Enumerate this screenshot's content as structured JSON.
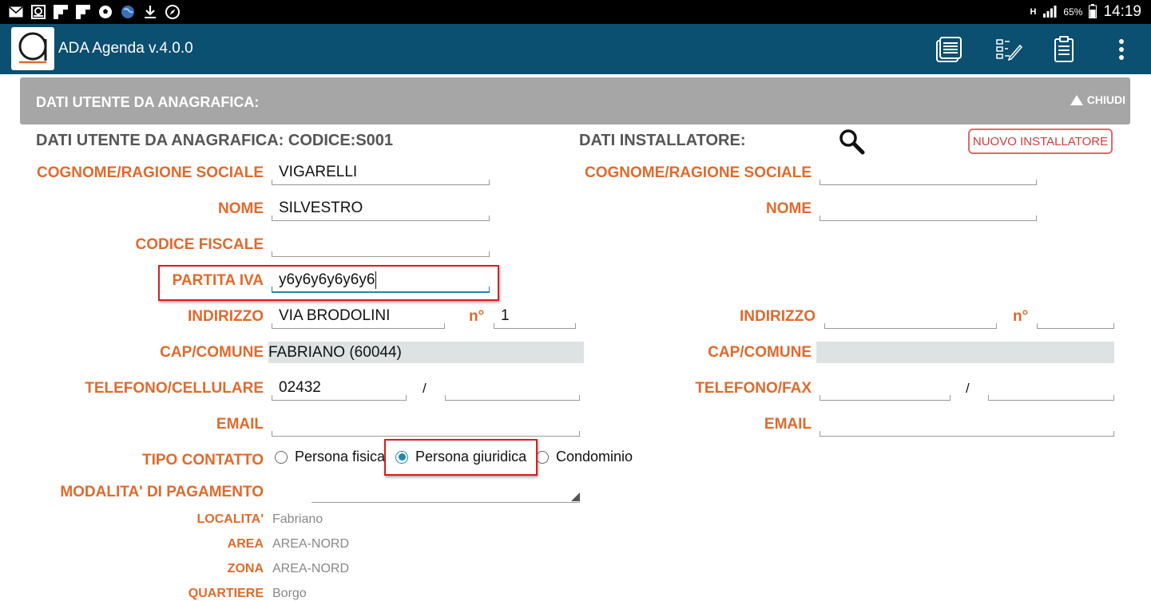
{
  "status_bar": {
    "icons": [
      "mail-icon",
      "quote-icon",
      "flipboard-icon",
      "flipboard-icon",
      "soccer-icon",
      "globe-icon",
      "download-icon",
      "compass-icon"
    ],
    "network": "H",
    "battery": "65%",
    "time": "14:19"
  },
  "app": {
    "title": "ADA Agenda v.4.0.0",
    "logo_letter": "a",
    "actions": [
      "document-list-icon",
      "edit-list-icon",
      "clipboard-icon",
      "overflow-menu-icon"
    ],
    "primary_color": "#0b4f71",
    "accent_color": "#e06a2b"
  },
  "section": {
    "title": "DATI UTENTE DA ANAGRAFICA:",
    "toggle": "CHIUDI"
  },
  "left": {
    "header": "DATI UTENTE DA ANAGRAFICA:  CODICE:S001",
    "labels": {
      "cognome": "COGNOME/RAGIONE SOCIALE",
      "nome": "NOME",
      "codice_fiscale": "CODICE FISCALE",
      "partita_iva": "PARTITA IVA",
      "indirizzo": "INDIRIZZO",
      "numero": "n°",
      "cap_comune": "CAP/COMUNE",
      "telefono": "TELEFONO/CELLULARE",
      "email": "EMAIL",
      "tipo_contatto": "TIPO CONTATTO",
      "pagamento": "MODALITA' DI PAGAMENTO",
      "localita": "LOCALITA'",
      "area": "AREA",
      "zona": "ZONA",
      "quartiere": "QUARTIERE"
    },
    "values": {
      "cognome": "VIGARELLI",
      "nome": "SILVESTRO",
      "codice_fiscale": "",
      "partita_iva": "y6y6y6y6y6y6",
      "indirizzo": "VIA BRODOLINI",
      "numero": "1",
      "cap_comune": "FABRIANO (60044)",
      "telefono": "02432",
      "cellulare": "",
      "phone_separator": "/",
      "email": "",
      "pagamento": "",
      "localita": "Fabriano",
      "area": "AREA-NORD",
      "zona": "AREA-NORD",
      "quartiere": "Borgo"
    },
    "tipo_contatto": {
      "options": [
        "Persona fisica",
        "Persona giuridica",
        "Condominio"
      ],
      "selected": "Persona giuridica"
    }
  },
  "right": {
    "header": "DATI INSTALLATORE:",
    "new_button": "NUOVO INSTALLATORE",
    "labels": {
      "cognome": "COGNOME/RAGIONE SOCIALE",
      "nome": "NOME",
      "indirizzo": "INDIRIZZO",
      "numero": "n°",
      "cap_comune": "CAP/COMUNE",
      "telefono": "TELEFONO/FAX",
      "email": "EMAIL"
    },
    "values": {
      "cognome": "",
      "nome": "",
      "indirizzo": "",
      "numero": "",
      "cap_comune": "",
      "telefono": "",
      "fax": "",
      "phone_separator": "/",
      "email": ""
    }
  }
}
